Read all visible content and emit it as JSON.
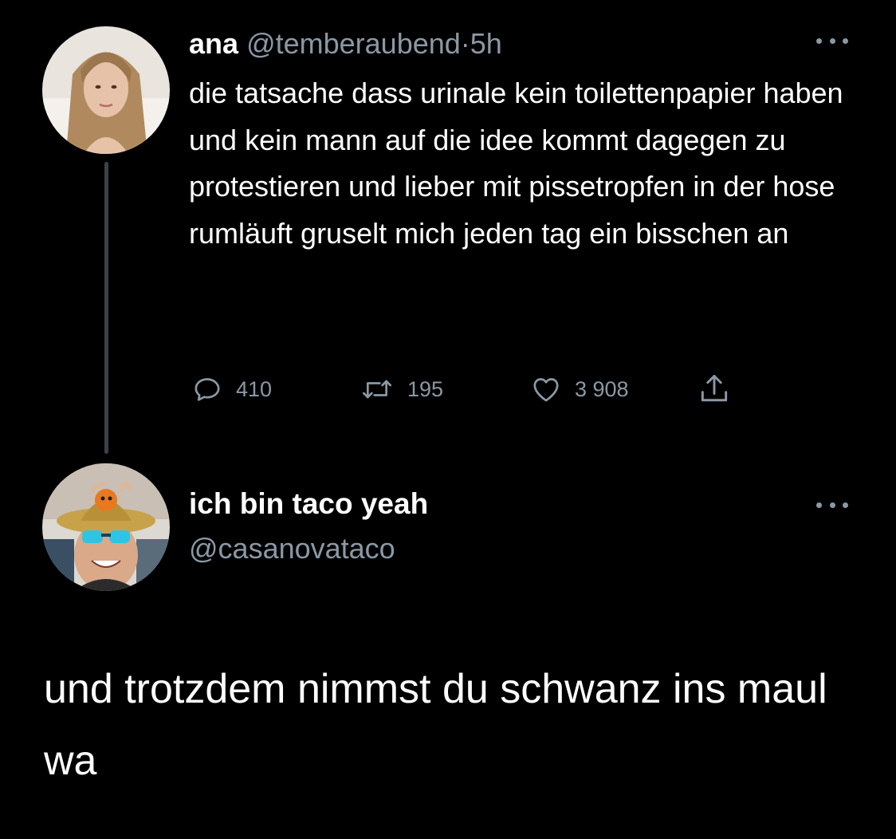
{
  "parent_tweet": {
    "display_name": "ana",
    "handle": "@temberaubend",
    "separator": "·",
    "time": "5h",
    "text": "die tatsache dass urinale kein toilettenpapier haben und kein mann auf die idee kommt dagegen zu protestieren und lieber mit pissetropfen in der hose rumläuft gruselt mich jeden tag ein bisschen an",
    "actions": {
      "reply_count": "410",
      "retweet_count": "195",
      "like_count": "3 908"
    }
  },
  "reply_tweet": {
    "display_name": "ich bin taco yeah",
    "handle": "@casanovataco",
    "text": "und trotzdem nimmst du schwanz ins maul wa"
  },
  "icons": {
    "reply": "speech-bubble-icon",
    "retweet": "retweet-arrows-icon",
    "like": "heart-icon",
    "share": "share-upload-icon",
    "more": "more-dots-icon"
  },
  "colors": {
    "background": "#000000",
    "text_primary": "#ffffff",
    "text_secondary": "#8b98a5",
    "thread_line": "#3b4248"
  }
}
